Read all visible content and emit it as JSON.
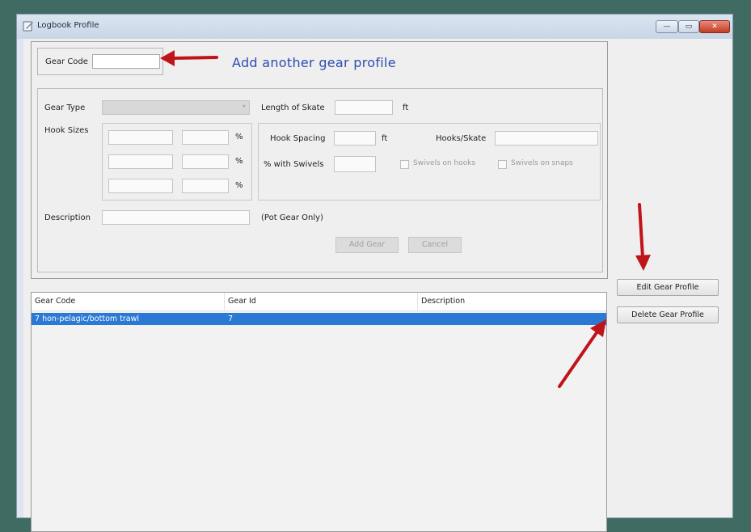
{
  "window": {
    "title": "Logbook Profile",
    "controls": {
      "minimize": "—",
      "maximize": "▭",
      "close": "✕"
    }
  },
  "form": {
    "gear_code_label": "Gear Code",
    "gear_code_value": "",
    "callout": "Add another gear profile",
    "gear_type_label": "Gear Type",
    "length_of_skate_label": "Length of Skate",
    "length_unit": "ft",
    "hook_sizes_label": "Hook Sizes",
    "percent": "%",
    "hook_spacing_label": "Hook Spacing",
    "hook_spacing_unit": "ft",
    "hooks_skate_label": "Hooks/Skate",
    "pct_swivels_label": "% with Swivels",
    "swivels_on_hooks_label": "Swivels on hooks",
    "swivels_on_snaps_label": "Swivels on snaps",
    "description_label": "Description",
    "pot_gear_note": "(Pot Gear Only)",
    "add_gear_button": "Add Gear",
    "cancel_button": "Cancel"
  },
  "list": {
    "columns": [
      "Gear Code",
      "Gear Id",
      "Description"
    ],
    "rows": [
      {
        "gear_code": "7 hon-pelagic/bottom trawl",
        "gear_id": "7",
        "description": ""
      }
    ]
  },
  "side_buttons": {
    "edit": "Edit Gear Profile",
    "delete": "Delete Gear Profile"
  },
  "colors": {
    "annotation_arrow": "#c0141b",
    "callout_text": "#2c4cb0",
    "selection": "#2a79d4"
  }
}
